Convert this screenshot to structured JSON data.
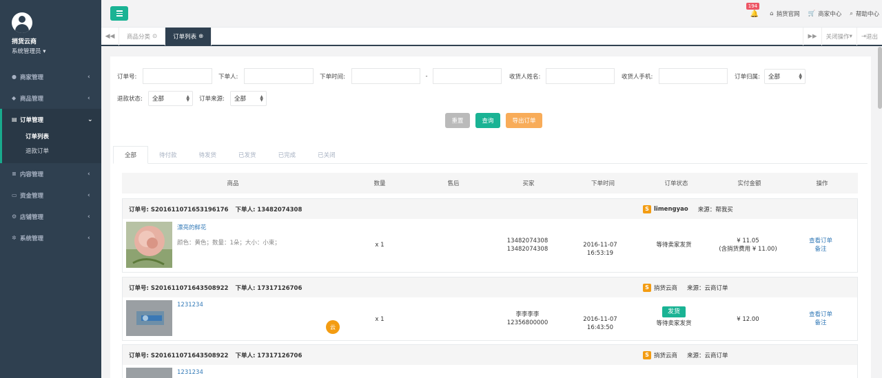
{
  "sidebar": {
    "user_name": "捎货云商",
    "user_role": "系统管理员",
    "menu": [
      {
        "label": "商家管理",
        "icon": "user-icon"
      },
      {
        "label": "商品管理",
        "icon": "tag-icon"
      },
      {
        "label": "订单管理",
        "icon": "receipt-icon",
        "active": true,
        "sub": [
          "订单列表",
          "退款订单"
        ]
      },
      {
        "label": "内容管理",
        "icon": "list-icon"
      },
      {
        "label": "资金管理",
        "icon": "card-icon"
      },
      {
        "label": "店铺管理",
        "icon": "cogs-icon"
      },
      {
        "label": "系统管理",
        "icon": "gear-icon"
      }
    ]
  },
  "topbar": {
    "badge_count": "194",
    "links": [
      "捎货官网",
      "商家中心",
      "帮助中心"
    ]
  },
  "tabsbar": {
    "tabs": [
      "商品分类",
      "订单列表"
    ],
    "close_ops": "关闭操作",
    "logout": "退出"
  },
  "filters": {
    "order_no": "订单号:",
    "orderer": "下单人:",
    "order_time": "下单时间:",
    "dash": "-",
    "receiver_name": "收货人姓名:",
    "receiver_phone": "收货人手机:",
    "order_owner": "订单归属:",
    "order_owner_value": "全部",
    "refund_status": "退款状态:",
    "refund_status_value": "全部",
    "order_source": "订单来源:",
    "order_source_value": "全部",
    "btn_reset": "重置",
    "btn_query": "查询",
    "btn_export": "导出订单"
  },
  "status_tabs": [
    "全部",
    "待付款",
    "待发货",
    "已发货",
    "已完成",
    "已关闭"
  ],
  "table_headers": [
    "商品",
    "数量",
    "售后",
    "买家",
    "下单时间",
    "订单状态",
    "实付金额",
    "操作"
  ],
  "orders": [
    {
      "order_no": "订单号: S201611071653196176",
      "orderer": "下单人: 13482074308",
      "shop": "limengyao",
      "source": "来源：帮我买",
      "product": "漂亮的鲜花",
      "attrs": "颜色：黄色；数量：1朵；大小：小束；",
      "qty": "x 1",
      "buyer1": "13482074308",
      "buyer2": "13482074308",
      "time": "2016-11-07 16:53:19",
      "status": "等待卖家发货",
      "amount": "¥ 11.05",
      "amount_note": "(含捎货费用 ¥ 11.00)",
      "op1": "查看订单",
      "op2": "备注"
    },
    {
      "order_no": "订单号: S201611071643508922",
      "orderer": "下单人: 17317126706",
      "shop": "捎货云商",
      "source": "来源：云商订单",
      "product": "1231234",
      "qty": "x 1",
      "cloud": "云",
      "buyer1": "李李李李",
      "buyer2": "12356800000",
      "time": "2016-11-07 16:43:50",
      "ship_btn": "发货",
      "status": "等待卖家发货",
      "amount": "¥ 12.00",
      "op1": "查看订单",
      "op2": "备注"
    },
    {
      "order_no": "订单号: S201611071643508922",
      "orderer": "下单人: 17317126706",
      "shop": "捎货云商",
      "source": "来源：云商订单",
      "product": "1231234"
    }
  ]
}
